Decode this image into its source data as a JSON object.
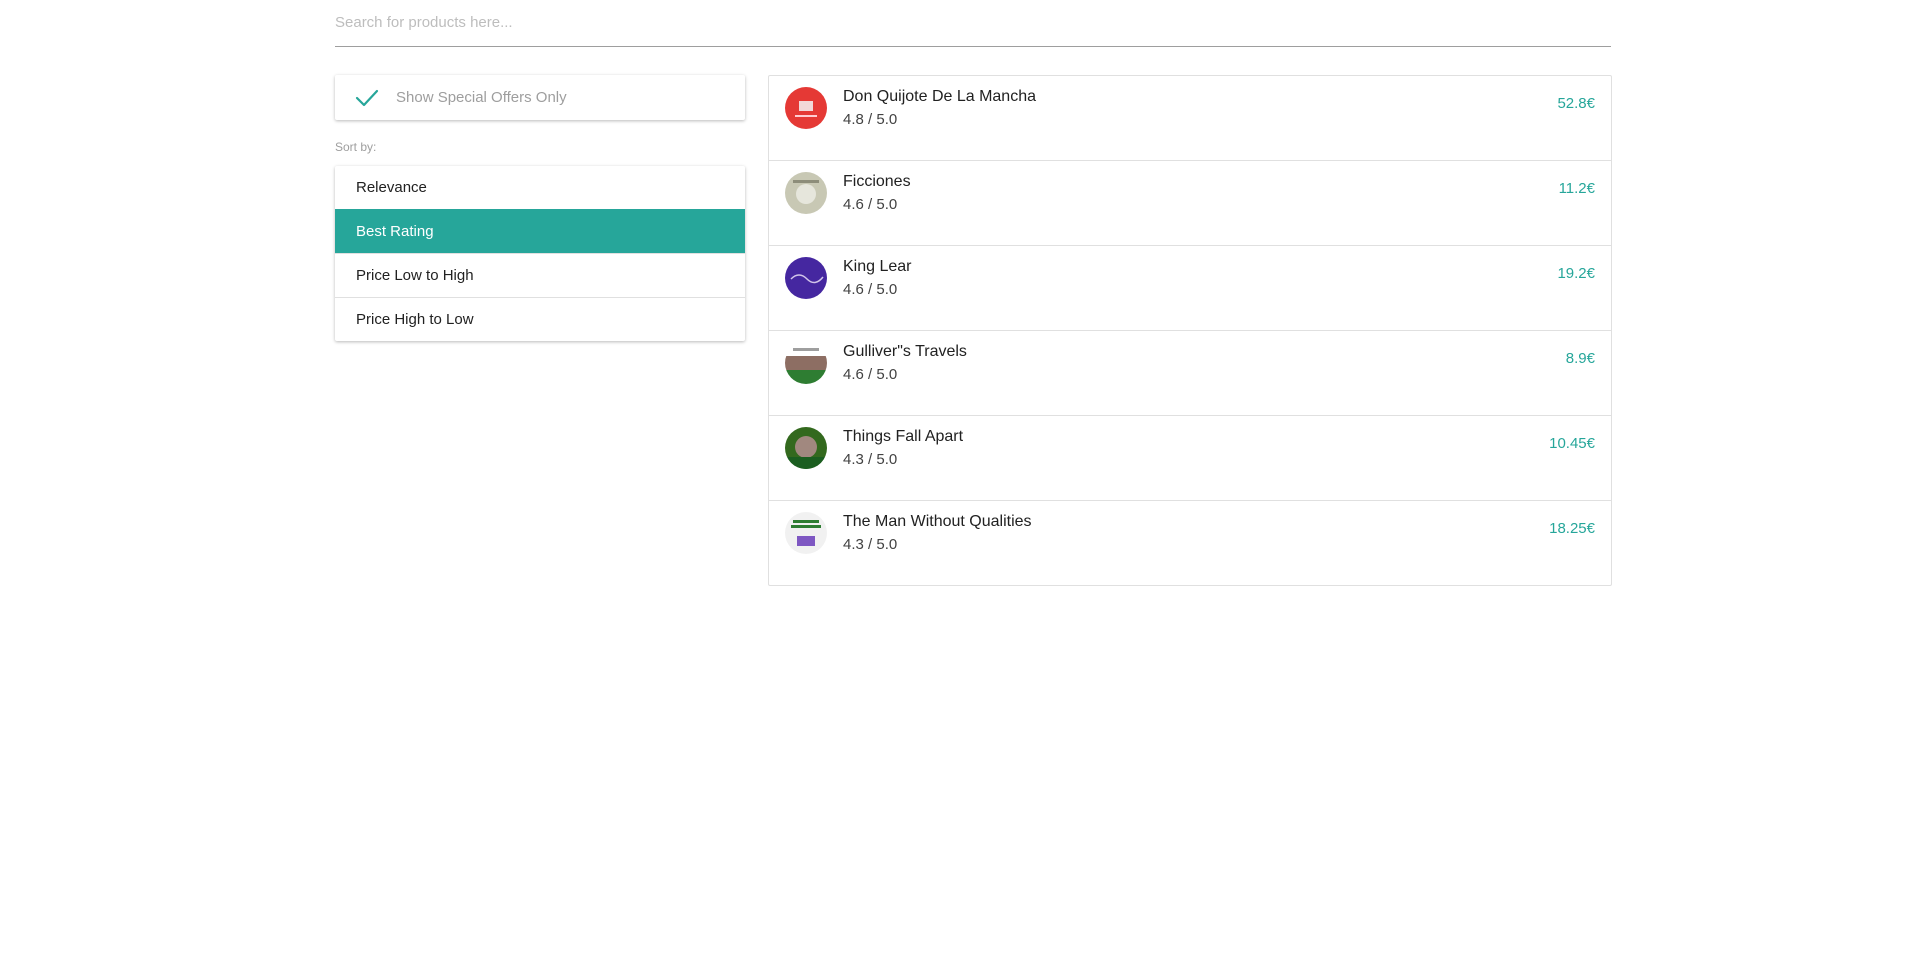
{
  "search": {
    "placeholder": "Search for products here...",
    "value": ""
  },
  "filters": {
    "special_offers_label": "Show Special Offers Only",
    "special_offers_checked": true,
    "sort_label": "Sort by:",
    "sort_options": [
      "Relevance",
      "Best Rating",
      "Price Low to High",
      "Price High to Low"
    ],
    "sort_selected": "Best Rating"
  },
  "products": [
    {
      "title": "Don Quijote De La Mancha",
      "rating": "4.8 / 5.0",
      "price": "52.8€",
      "image_icon": "book-cover-red"
    },
    {
      "title": "Ficciones",
      "rating": "4.6 / 5.0",
      "price": "11.2€",
      "image_icon": "book-cover-grey"
    },
    {
      "title": "King Lear",
      "rating": "4.6 / 5.0",
      "price": "19.2€",
      "image_icon": "book-cover-purple"
    },
    {
      "title": "Gulliver\"s Travels",
      "rating": "4.6 / 5.0",
      "price": "8.9€",
      "image_icon": "book-cover-landscape"
    },
    {
      "title": "Things Fall Apart",
      "rating": "4.3 / 5.0",
      "price": "10.45€",
      "image_icon": "book-cover-green"
    },
    {
      "title": "The Man Without Qualities",
      "rating": "4.3 / 5.0",
      "price": "18.25€",
      "image_icon": "book-cover-white"
    }
  ],
  "colors": {
    "accent": "#26a69a",
    "text": "#212121",
    "muted": "#9e9e9e",
    "border": "#e0e0e0"
  }
}
